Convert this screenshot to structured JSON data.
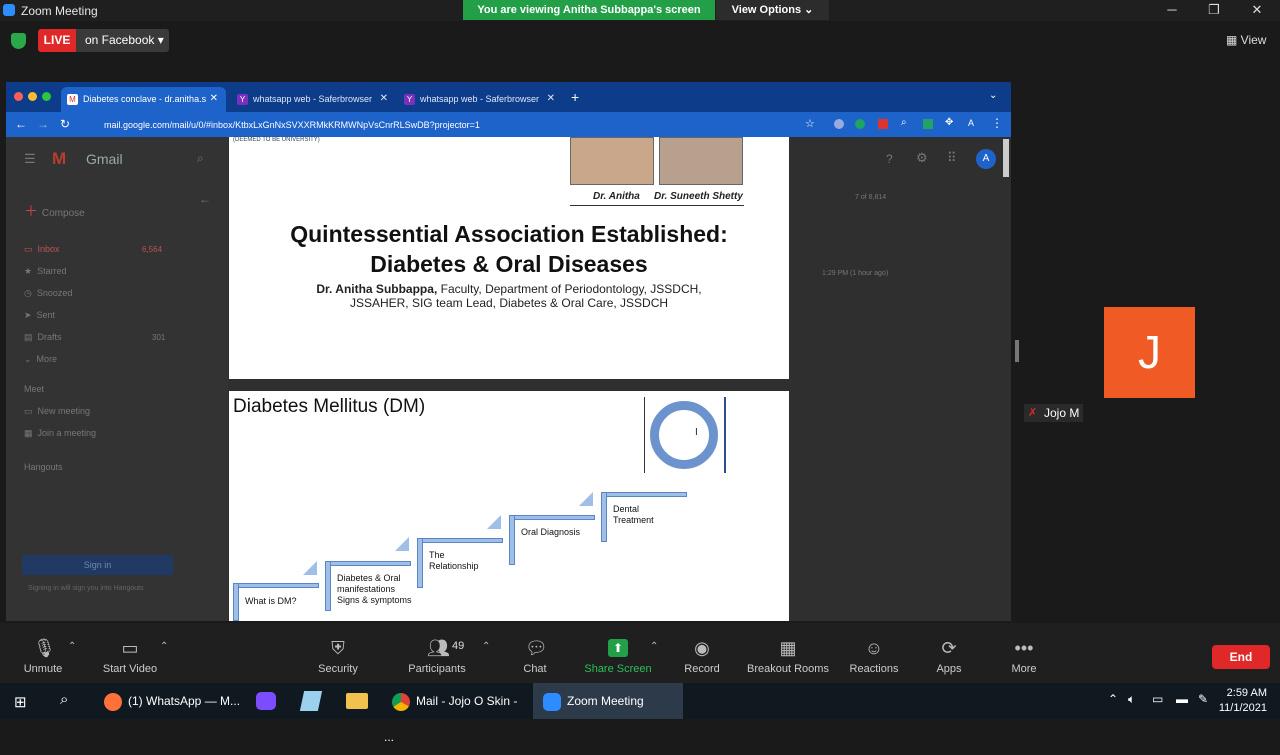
{
  "window": {
    "title": "Zoom Meeting",
    "share_banner": "You are viewing Anitha Subbappa's screen",
    "view_options": "View Options ⌄"
  },
  "live": {
    "badge": "LIVE",
    "where": "on Facebook ▾",
    "view": "View"
  },
  "browser": {
    "tabs": [
      {
        "label": "Diabetes conclave - dr.anitha.s"
      },
      {
        "label": "whatsapp web - Saferbrowser"
      },
      {
        "label": "whatsapp web - Saferbrowser"
      }
    ],
    "url": "mail.google.com/mail/u/0/#inbox/KtbxLxGnNxSVXXRMkKRMWNpVsCnrRLSwDB?projector=1"
  },
  "gmail": {
    "logo": "Gmail",
    "compose": "Compose",
    "items": [
      "Inbox",
      "Starred",
      "Snoozed",
      "Sent",
      "Drafts",
      "More"
    ],
    "inbox_count": "6,564",
    "drafts_count": "301",
    "meet": "Meet",
    "meet_items": [
      "New meeting",
      "Join a meeting"
    ],
    "hangouts": "Hangouts",
    "sign_in": "Sign in",
    "sign_in_note": "Signing in will sign you into Hangouts",
    "pager": "7 of 8,814",
    "time": "1:29 PM (1 hour ago)"
  },
  "slide1": {
    "title_line1": "Quintessential Association Established:",
    "title_line2": "Diabetes & Oral Diseases",
    "author_name": "Dr. Anitha Subbappa,",
    "author_rest": " Faculty, Department of Periodontology, JSSDCH,",
    "author_line2": "JSSAHER, SIG team Lead, Diabetes & Oral Care, JSSDCH",
    "caption1": "Dr. Anitha",
    "caption2": "Dr. Suneeth Shetty",
    "header_text": "(DEEMED TO BE UNIVERSITY)"
  },
  "slide2": {
    "title": "Diabetes Mellitus (DM)",
    "steps": [
      "What is DM?",
      "Diabetes & Oral manifestations Signs & symptoms",
      "The Relationship",
      "Oral Diagnosis",
      "Dental Treatment"
    ]
  },
  "participant": {
    "initial": "J",
    "name": "Jojo M"
  },
  "toolbar": {
    "unmute": "Unmute",
    "start_video": "Start Video",
    "security": "Security",
    "participants": "Participants",
    "participants_count": "49",
    "chat": "Chat",
    "share_screen": "Share Screen",
    "record": "Record",
    "breakout": "Breakout Rooms",
    "reactions": "Reactions",
    "apps": "Apps",
    "more": "More",
    "end": "End"
  },
  "taskbar": {
    "items": [
      "(1) WhatsApp — M...",
      "Mail - Jojo O Skin - ...",
      "Zoom Meeting"
    ],
    "time": "2:59 AM",
    "date": "11/1/2021"
  },
  "colors": {
    "zoom_green": "#23a047",
    "live_red": "#e02828",
    "avatar_orange": "#f05a24",
    "chrome_blue": "#1e63c9"
  }
}
